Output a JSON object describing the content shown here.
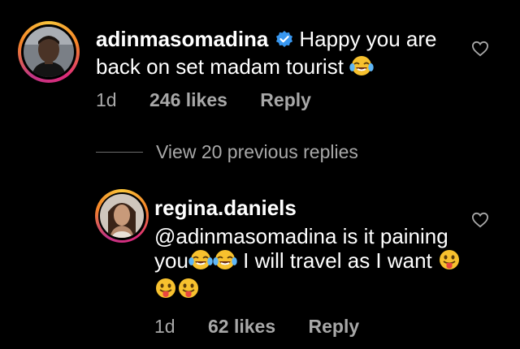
{
  "comment": {
    "username": "adinmasomadina",
    "text": "Happy you are back on set madam tourist",
    "emoji": "face-with-tears-of-joy",
    "age": "1d",
    "likes": "246 likes",
    "reply_label": "Reply"
  },
  "view_replies": "View 20 previous replies",
  "reply": {
    "username": "regina.daniels",
    "mention": "@adinmasomadina",
    "text_part1": "is it paining you",
    "text_part2": "I will travel as I want",
    "age": "1d",
    "likes": "62 likes",
    "reply_label": "Reply"
  },
  "colors": {
    "background": "#000000",
    "text": "#ffffff",
    "meta": "#a8a8a8",
    "verified": "#3897f0"
  }
}
